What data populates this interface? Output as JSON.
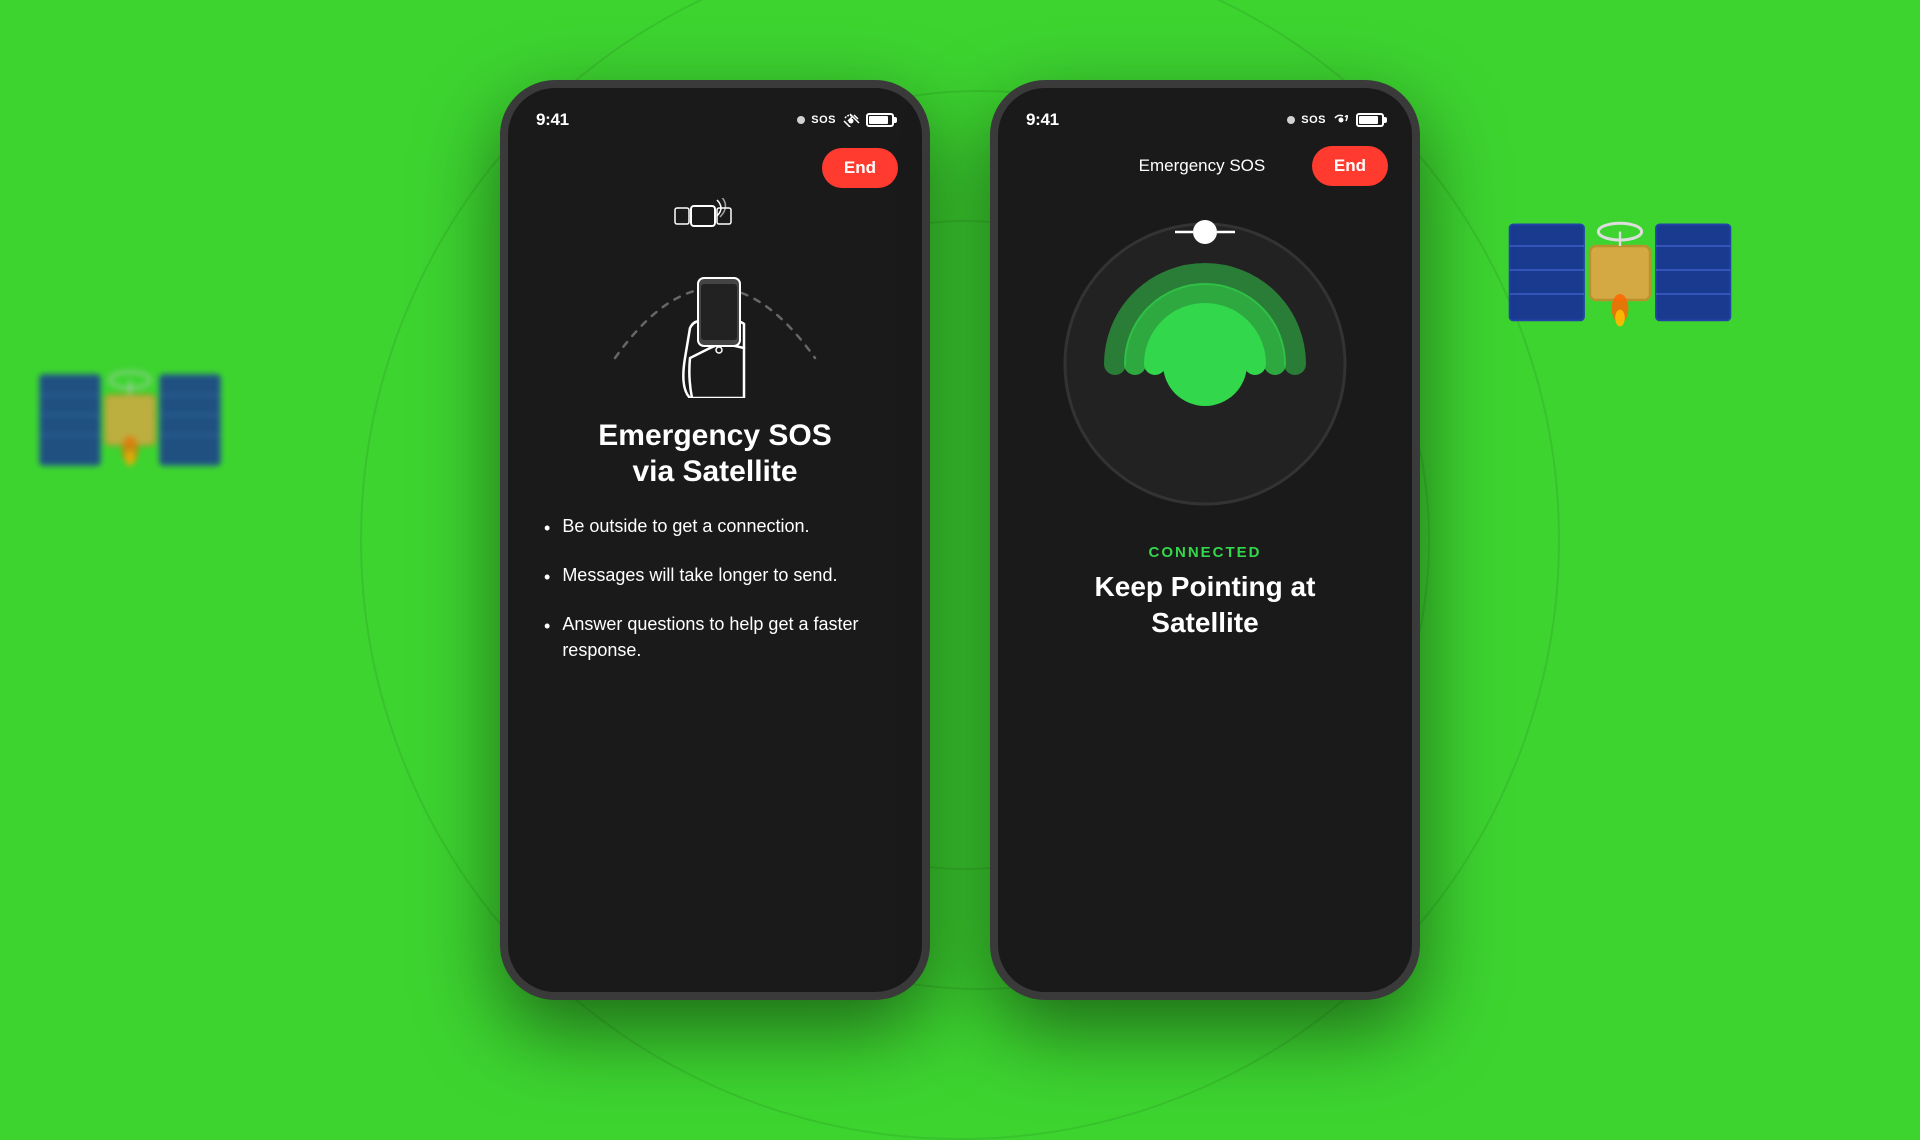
{
  "background": {
    "color": "#3dd430"
  },
  "phone1": {
    "time": "9:41",
    "sos_label": "SOS",
    "end_button": "End",
    "title_line1": "Emergency SOS",
    "title_line2": "via Satellite",
    "bullets": [
      "Be outside to get a connection.",
      "Messages will take longer to send.",
      "Answer questions to help get a faster response."
    ]
  },
  "phone2": {
    "time": "9:41",
    "sos_label": "SOS",
    "nav_title": "Emergency SOS",
    "end_button": "End",
    "connected_label": "CONNECTED",
    "subtitle_line1": "Keep Pointing at",
    "subtitle_line2": "Satellite"
  }
}
